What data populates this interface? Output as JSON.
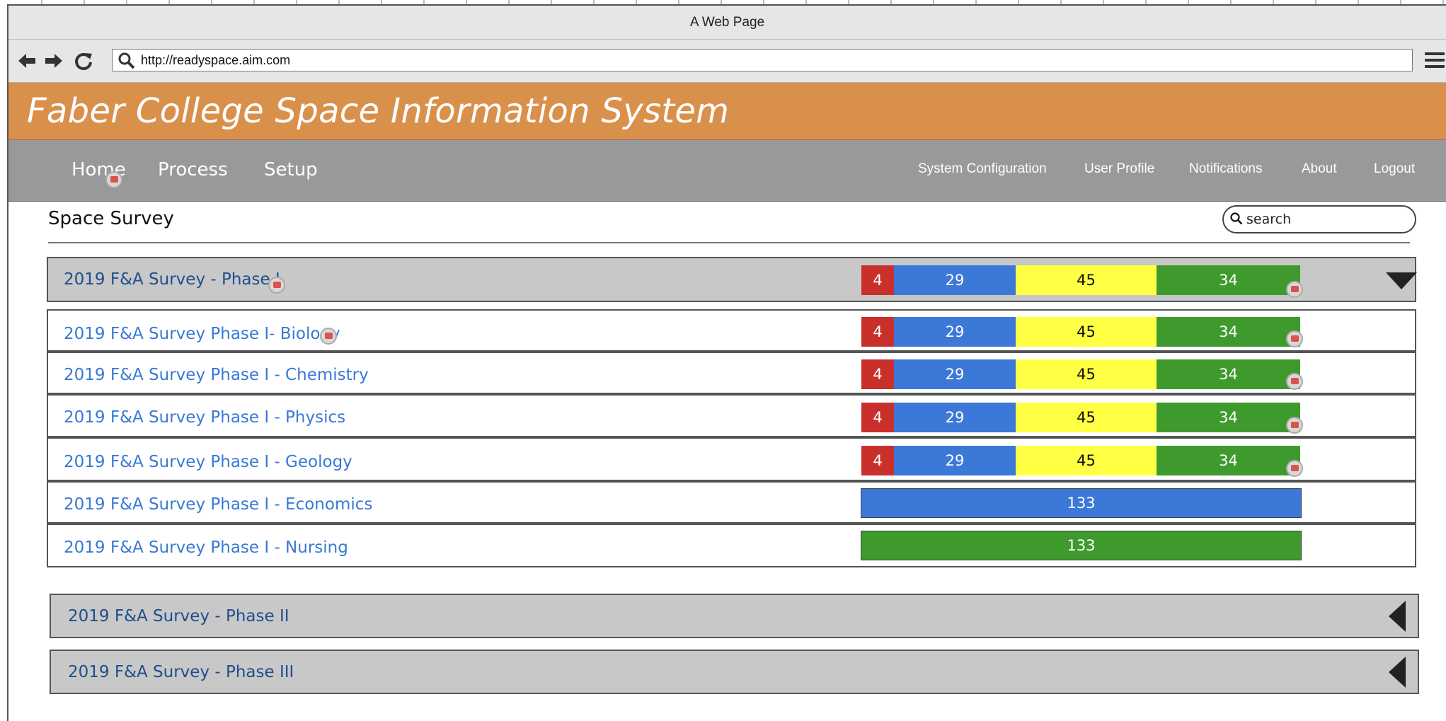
{
  "browser": {
    "title": "A Web Page",
    "url": "http://readyspace.aim.com"
  },
  "app": {
    "title": "Faber College Space Information System"
  },
  "nav": {
    "left": [
      "Home",
      "Process",
      "Setup"
    ],
    "right": [
      "System Configuration",
      "User Profile",
      "Notifications",
      "About",
      "Logout"
    ]
  },
  "page": {
    "title": "Space Survey",
    "search_placeholder": "search"
  },
  "colors": {
    "red": "#c9302c",
    "blue": "#3c78d8",
    "yellow": "#ffff44",
    "green": "#3f9a2e",
    "banner": "#d9904a",
    "nav": "#999999"
  },
  "phase1": {
    "label": "2019 F&A Survey - Phase I",
    "bar": [
      "4",
      "29",
      "45",
      "34"
    ],
    "items": [
      {
        "label": "2019 F&A Survey Phase I- Biology",
        "bar": [
          "4",
          "29",
          "45",
          "34"
        ]
      },
      {
        "label": "2019 F&A Survey Phase I - Chemistry",
        "bar": [
          "4",
          "29",
          "45",
          "34"
        ]
      },
      {
        "label": "2019 F&A Survey Phase I - Physics",
        "bar": [
          "4",
          "29",
          "45",
          "34"
        ]
      },
      {
        "label": "2019 F&A Survey Phase I - Geology",
        "bar": [
          "4",
          "29",
          "45",
          "34"
        ]
      },
      {
        "label": "2019 F&A Survey Phase I - Economics",
        "total": "133",
        "color": "blue"
      },
      {
        "label": "2019 F&A Survey Phase I - Nursing",
        "total": "133",
        "color": "green"
      }
    ]
  },
  "phase2": {
    "label": "2019 F&A Survey - Phase II"
  },
  "phase3": {
    "label": "2019 F&A Survey - Phase III"
  }
}
